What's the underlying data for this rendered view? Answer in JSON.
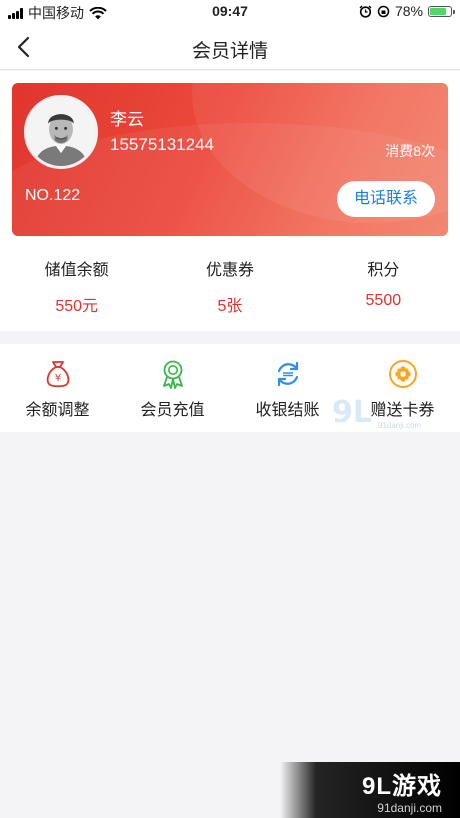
{
  "status_bar": {
    "carrier": "中国移动",
    "time": "09:47",
    "battery": "78%",
    "battery_level": 0.78
  },
  "nav": {
    "title": "会员详情",
    "back_icon": "chevron-left-icon"
  },
  "member": {
    "name": "李云",
    "phone": "15575131244",
    "number": "NO.122",
    "consume": "消费8次",
    "call_button": "电话联系",
    "call_color": "#1e7ee0"
  },
  "stats": [
    {
      "label": "储值余额",
      "value": "550元"
    },
    {
      "label": "优惠券",
      "value": "5张"
    },
    {
      "label": "积分",
      "value": "5500"
    }
  ],
  "actions": [
    {
      "label": "余额调整",
      "icon": "money-bag-icon",
      "color": "#e0332c"
    },
    {
      "label": "会员充值",
      "icon": "award-ribbon-icon",
      "color": "#3cb44a"
    },
    {
      "label": "收银结账",
      "icon": "refresh-cycle-icon",
      "color": "#2f8fe6"
    },
    {
      "label": "赠送卡券",
      "icon": "flower-coupon-icon",
      "color": "#f5a623"
    }
  ],
  "watermark": {
    "site": "91danji.com",
    "brand": "9L游戏",
    "domain": "91danji.com"
  },
  "colors": {
    "accent_red": "#e0332c",
    "card_gradient_start": "#e0352e",
    "card_gradient_end": "#f28068"
  }
}
